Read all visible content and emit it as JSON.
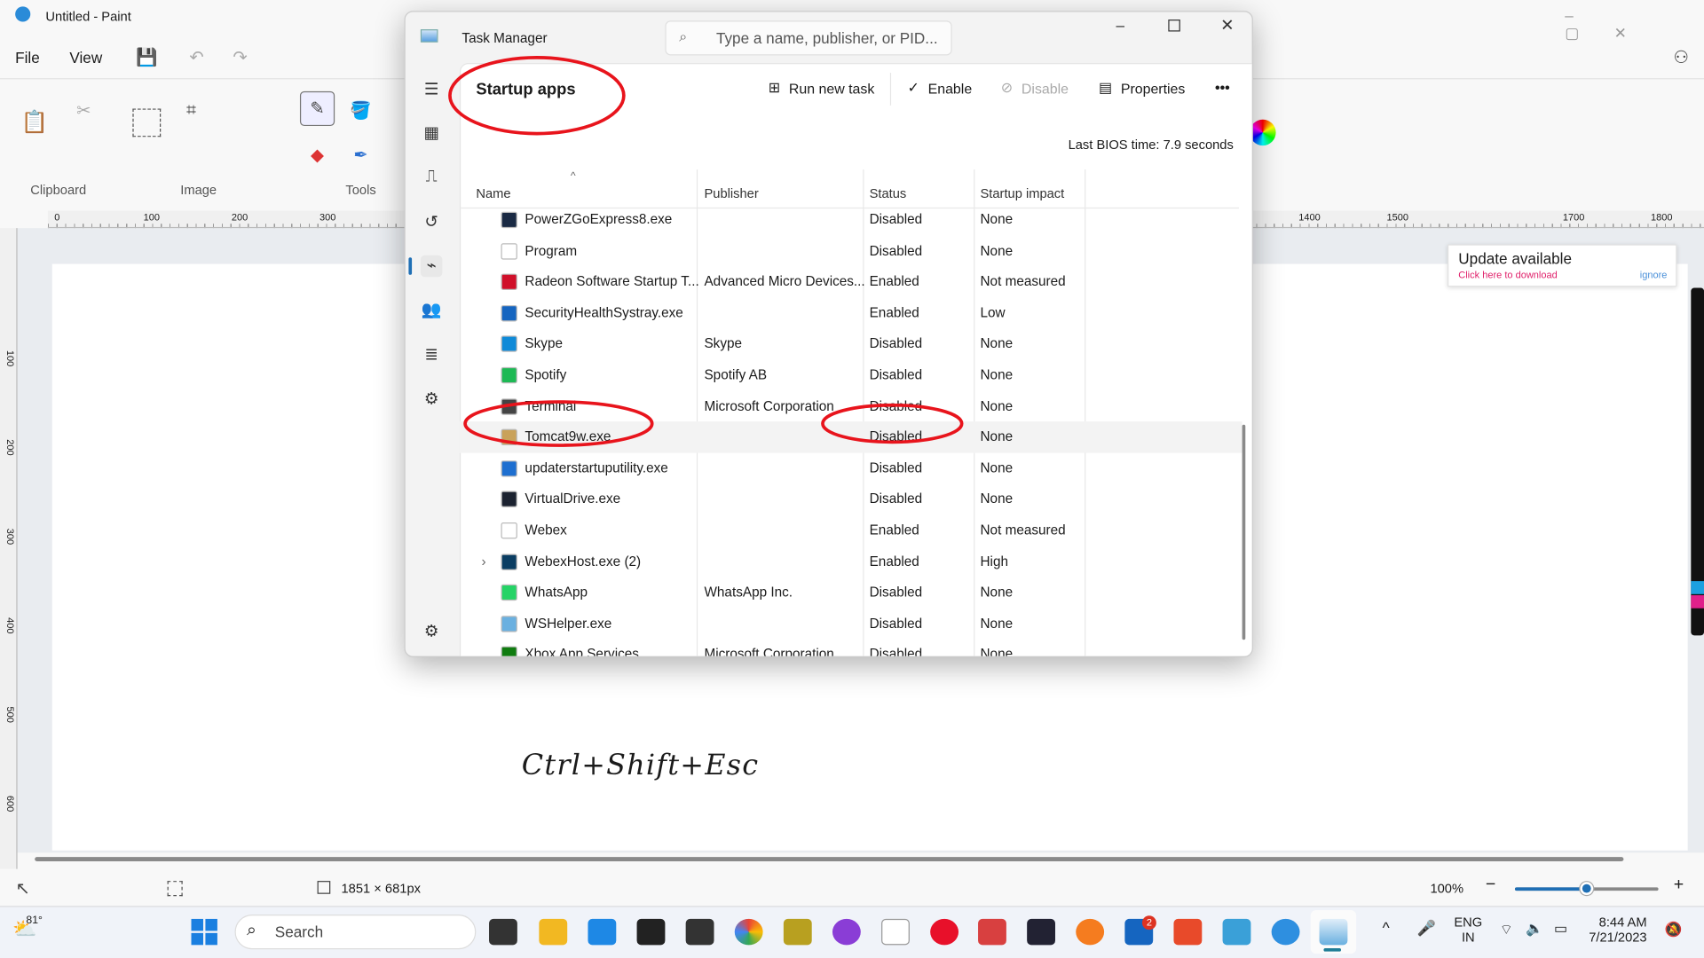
{
  "paint": {
    "title": "Untitled - Paint",
    "menu": [
      "File",
      "View"
    ],
    "groups": [
      "Clipboard",
      "Image",
      "Tools"
    ],
    "ruler_h": [
      "0",
      "100",
      "200",
      "300",
      "1400",
      "1500",
      "1700",
      "1800"
    ],
    "ruler_v": [
      "100",
      "200",
      "300",
      "400",
      "500",
      "600"
    ],
    "canvas_text": "Ctrl+Shift+Esc",
    "size": "1851 × 681px",
    "zoom": "100%",
    "zoom_level": 0.5
  },
  "update_popup": {
    "title": "Update available",
    "link": "Click here to download",
    "ignore": "ignore"
  },
  "task_manager": {
    "title": "Task Manager",
    "search_placeholder": "Type a name, publisher, or PID...",
    "page_title": "Startup apps",
    "commands": {
      "run": "Run new task",
      "enable": "Enable",
      "disable": "Disable",
      "properties": "Properties",
      "more": "•••"
    },
    "bios": "Last BIOS time:  7.9 seconds",
    "columns": [
      "Name",
      "Publisher",
      "Status",
      "Startup impact"
    ],
    "rows": [
      {
        "name": "PowerZGoExpress8.exe",
        "publisher": "",
        "status": "Disabled",
        "impact": "None",
        "color": "#1a2a44"
      },
      {
        "name": "Program",
        "publisher": "",
        "status": "Disabled",
        "impact": "None",
        "color": "#ffffff"
      },
      {
        "name": "Radeon Software Startup T...",
        "publisher": "Advanced Micro Devices...",
        "status": "Enabled",
        "impact": "Not measured",
        "color": "#d0102a"
      },
      {
        "name": "SecurityHealthSystray.exe",
        "publisher": "",
        "status": "Enabled",
        "impact": "Low",
        "color": "#1565c0"
      },
      {
        "name": "Skype",
        "publisher": "Skype",
        "status": "Disabled",
        "impact": "None",
        "color": "#0f8ad8"
      },
      {
        "name": "Spotify",
        "publisher": "Spotify AB",
        "status": "Disabled",
        "impact": "None",
        "color": "#1db954"
      },
      {
        "name": "Terminal",
        "publisher": "Microsoft Corporation",
        "status": "Disabled",
        "impact": "None",
        "color": "#444444"
      },
      {
        "name": "Tomcat9w.exe",
        "publisher": "",
        "status": "Disabled",
        "impact": "None",
        "color": "#c9a25a"
      },
      {
        "name": "updaterstartuputility.exe",
        "publisher": "",
        "status": "Disabled",
        "impact": "None",
        "color": "#1e6fd0"
      },
      {
        "name": "VirtualDrive.exe",
        "publisher": "",
        "status": "Disabled",
        "impact": "None",
        "color": "#1b2230"
      },
      {
        "name": "Webex",
        "publisher": "",
        "status": "Enabled",
        "impact": "Not measured",
        "color": "#ffffff"
      },
      {
        "name": "WebexHost.exe (2)",
        "publisher": "",
        "status": "Enabled",
        "impact": "High",
        "color": "#0a3d62"
      },
      {
        "name": "WhatsApp",
        "publisher": "WhatsApp Inc.",
        "status": "Disabled",
        "impact": "None",
        "color": "#25d366"
      },
      {
        "name": "WSHelper.exe",
        "publisher": "",
        "status": "Disabled",
        "impact": "None",
        "color": "#6ab0e0"
      },
      {
        "name": "Xbox App Services",
        "publisher": "Microsoft Corporation",
        "status": "Disabled",
        "impact": "None",
        "color": "#107c10"
      }
    ]
  },
  "taskbar": {
    "weather": "81°",
    "search": "Search",
    "lang1": "ENG",
    "lang2": "IN",
    "time": "8:44 AM",
    "date": "7/21/2023",
    "badge": "2"
  },
  "annotation_color": "#e8141c"
}
